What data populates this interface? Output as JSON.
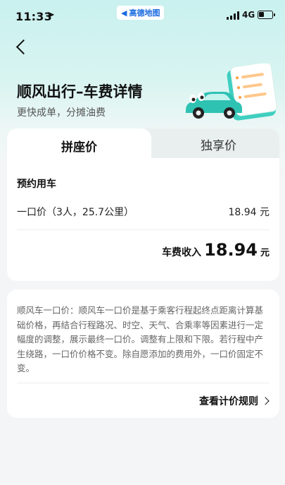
{
  "status_bar": {
    "time": "11:33",
    "app_name": "高德地图",
    "network": "4G"
  },
  "header": {
    "title": "顺风出行–车费详情",
    "subtitle": "更快成单，分摊油费"
  },
  "tabs": [
    {
      "label": "拼座价",
      "active": true
    },
    {
      "label": "独享价",
      "active": false
    }
  ],
  "fare": {
    "section_title": "预约用车",
    "row_label": "一口价（3人，25.7公里）",
    "row_value": "18.94 元",
    "income_label": "车费收入",
    "income_amount": "18.94",
    "income_unit": "元"
  },
  "rules": {
    "description": "顺风车一口价：顺风车一口价是基于乘客行程起终点距离计算基础价格，再结合行程路况、时空、天气、合乘率等因素进行一定幅度的调整，展示最终一口价。调整有上限和下限。若行程中产生绕路，一口价价格不变。除自愿添加的费用外，一口价固定不变。",
    "link_label": "查看计价规则"
  },
  "colors": {
    "accent_teal": "#3ecfc0",
    "hero_bg": "#c9f1ef",
    "page_bg": "#f4f5f7"
  }
}
